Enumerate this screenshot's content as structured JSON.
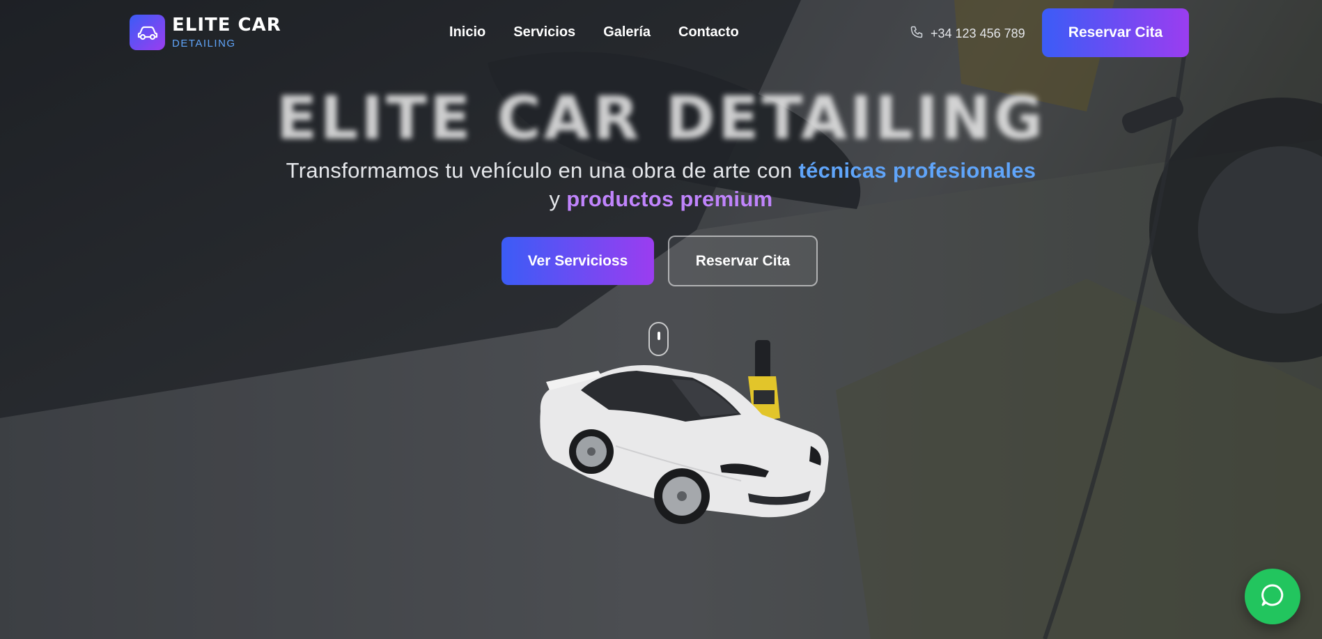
{
  "brand": {
    "title": "ELITE CAR",
    "subtitle": "DETAILING",
    "logo_icon": "car-icon"
  },
  "nav": {
    "items": [
      {
        "label": "Inicio"
      },
      {
        "label": "Servicios"
      },
      {
        "label": "Galería"
      },
      {
        "label": "Contacto"
      }
    ]
  },
  "contact": {
    "phone": "+34 123 456 789",
    "phone_icon": "phone-icon",
    "cta_label": "Reservar Cita"
  },
  "hero": {
    "title": "ELITE CAR DETAILING",
    "subtitle_part1": "Transformamos tu vehículo en una obra de arte con ",
    "subtitle_highlight1": "técnicas profesionales",
    "subtitle_part2": " y ",
    "subtitle_highlight2": "productos premium",
    "primary_button": "Ver Servicioss",
    "secondary_button": "Reservar Cita"
  },
  "floating": {
    "chat_icon": "whatsapp-chat-icon"
  },
  "colors": {
    "accent_blue": "#3b5cf6",
    "accent_purple": "#9b3df0",
    "highlight_blue": "#60a5fa",
    "highlight_purple": "#c084fc",
    "whatsapp_green": "#22c55e"
  }
}
